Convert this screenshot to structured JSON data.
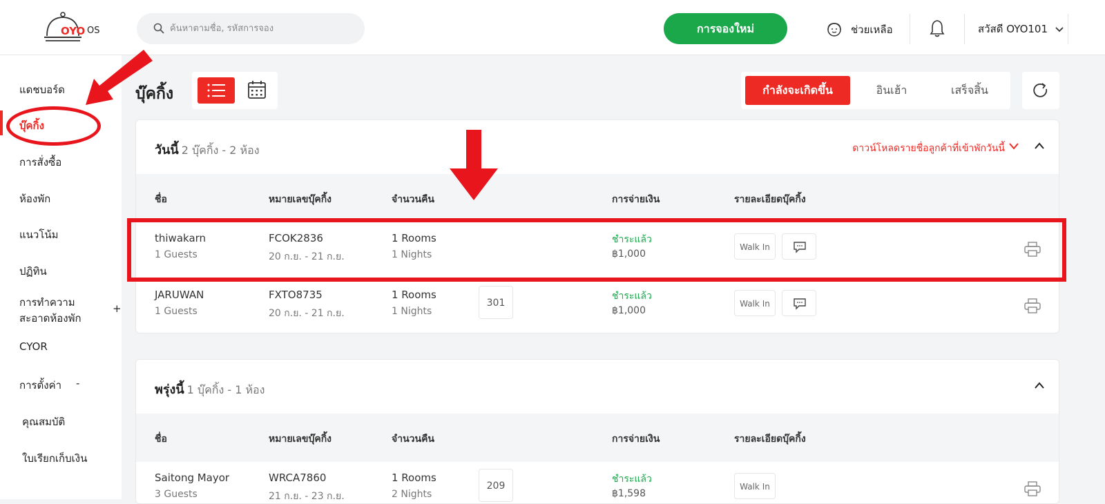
{
  "header": {
    "brand": "OYO",
    "brand_suffix": "OS",
    "search_placeholder": "ค้นหาตามชื่อ, รหัสการจอง",
    "new_booking": "การจองใหม่",
    "help": "ช่วยเหลือ",
    "user": "สวัสดี OYO101"
  },
  "sidebar": {
    "items": [
      {
        "label": "แดชบอร์ด"
      },
      {
        "label": "บุ๊คกิ้ง"
      },
      {
        "label": "การสั่งซื้อ"
      },
      {
        "label": "ห้องพัก"
      },
      {
        "label": "แนวโน้ม"
      },
      {
        "label": "ปฏิทิน"
      },
      {
        "label": "การทำความ"
      },
      {
        "label": "สะอาดห้องพัก"
      },
      {
        "label": "CYOR"
      },
      {
        "label": "การตั้งค่า"
      },
      {
        "label": "คุณสมบัติ"
      },
      {
        "label": "ใบเรียกเก็บเงิน"
      }
    ],
    "plus": "+",
    "minus": "-"
  },
  "page": {
    "title": "บุ๊คกิ้ง",
    "tabs": [
      "กำลังจะเกิดขึ้น",
      "อินเฮ้า",
      "เสร็จสิ้น"
    ]
  },
  "columns": [
    "ชื่อ",
    "หมายเลขบุ๊คกิ้ง",
    "จำนวนคืน",
    "การจ่ายเงิน",
    "รายละเอียดบุ๊คกิ้ง"
  ],
  "today": {
    "title": "วันนี้",
    "summary": "2 บุ๊คกิ้ง - 2 ห้อง",
    "download": "ดาวน์โหลดรายชื่อลูกค้าที่เข้าพักวันนี้",
    "rows": [
      {
        "name": "thiwakarn",
        "guests": "1 Guests",
        "booking_id": "FCOK2836",
        "dates": "20 ก.ย. - 21 ก.ย.",
        "rooms": "1 Rooms",
        "nights": "1 Nights",
        "room_no": "",
        "status": "ชำระแล้ว",
        "amount": "฿1,000",
        "source": "Walk In"
      },
      {
        "name": "JARUWAN",
        "guests": "1 Guests",
        "booking_id": "FXTO8735",
        "dates": "20 ก.ย. - 21 ก.ย.",
        "rooms": "1 Rooms",
        "nights": "1 Nights",
        "room_no": "301",
        "status": "ชำระแล้ว",
        "amount": "฿1,000",
        "source": "Walk In"
      }
    ]
  },
  "tomorrow": {
    "title": "พรุ่งนี้",
    "summary": "1 บุ๊คกิ้ง - 1 ห้อง",
    "rows": [
      {
        "name": "Saitong Mayor",
        "guests": "3 Guests",
        "booking_id": "WRCA7860",
        "dates": "21 ก.ย. - 23 ก.ย.",
        "rooms": "1 Rooms",
        "nights": "2 Nights",
        "room_no": "209",
        "status": "ชำระแล้ว",
        "amount": "฿1,598",
        "source": "Walk In"
      }
    ]
  },
  "colors": {
    "accent": "#ee2a24",
    "green": "#1aa84b",
    "annotation": "#e8151d"
  }
}
